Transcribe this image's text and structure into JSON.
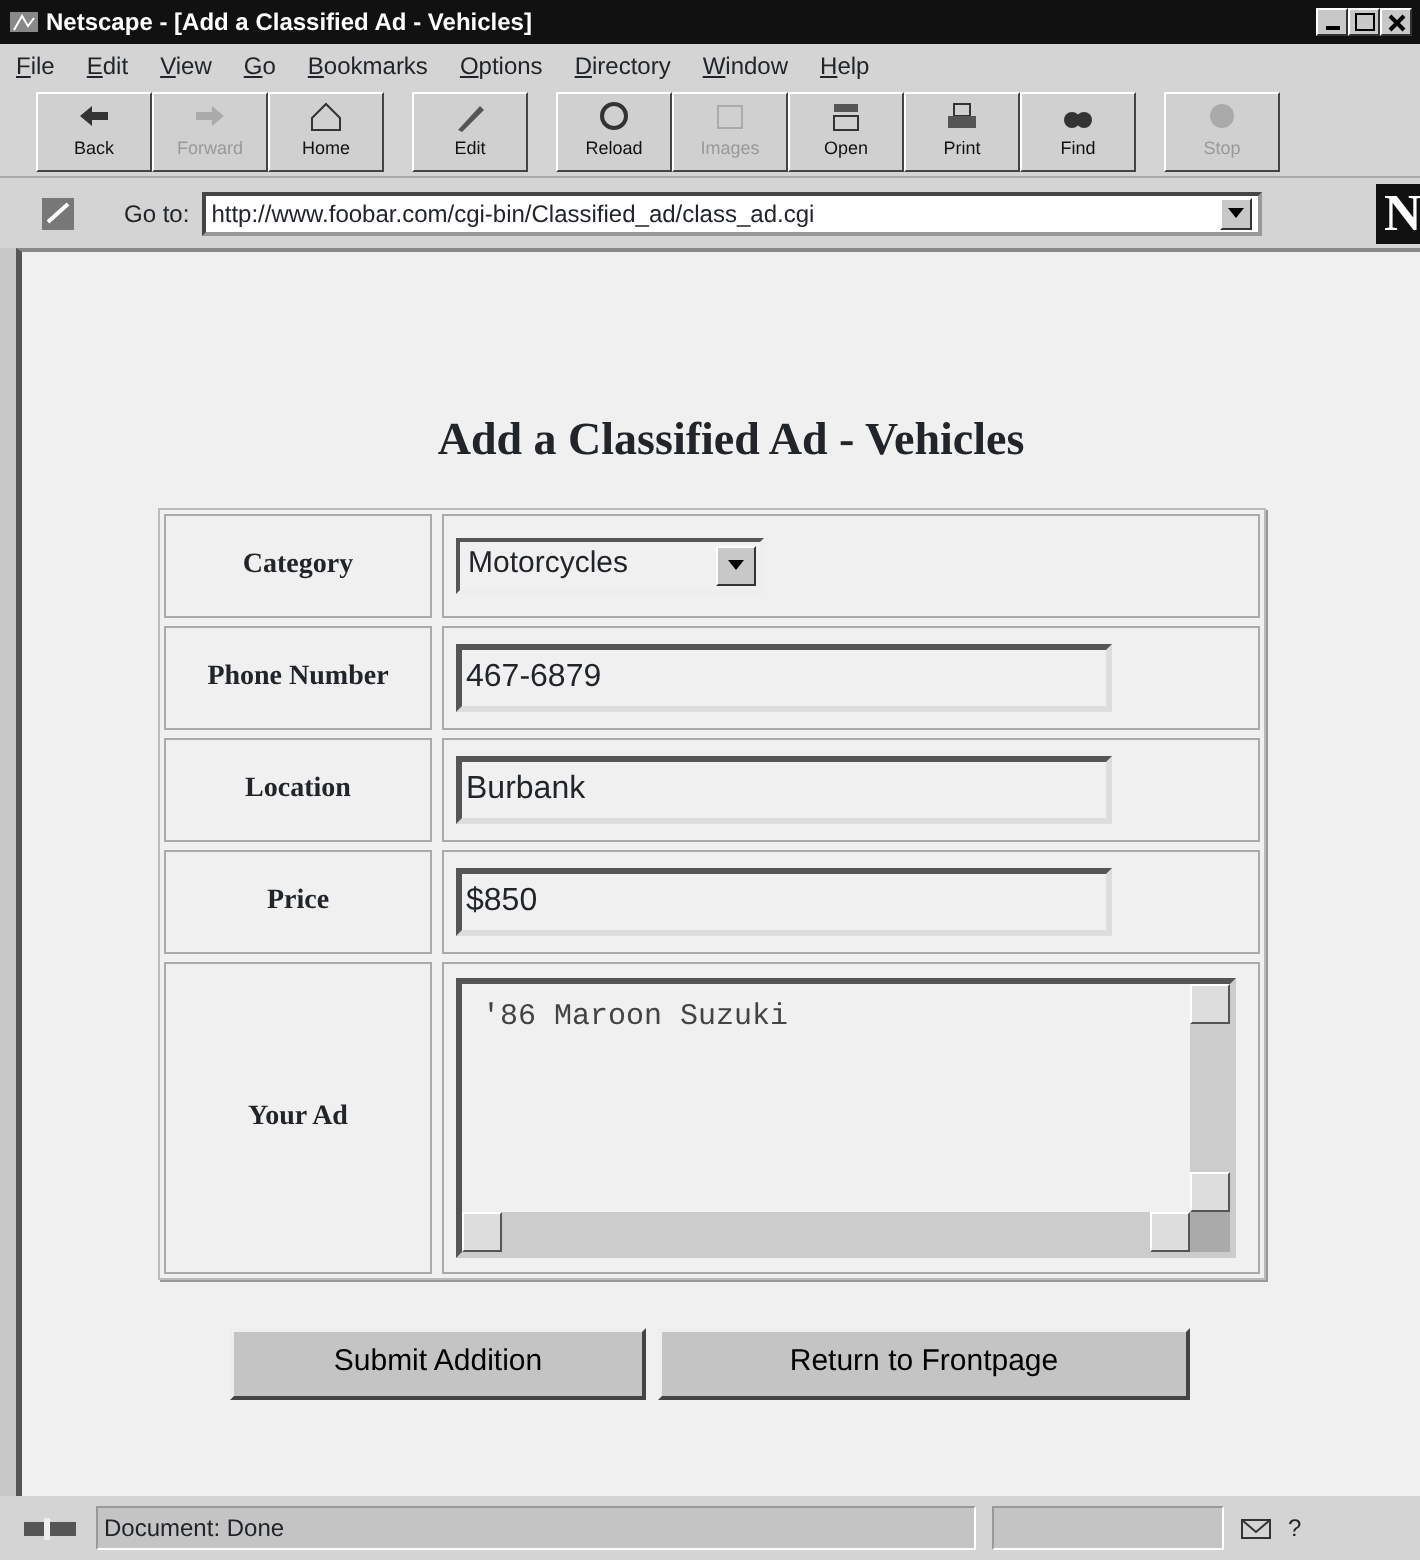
{
  "window": {
    "title": "Netscape - [Add a Classified Ad - Vehicles]"
  },
  "menu": [
    "File",
    "Edit",
    "View",
    "Go",
    "Bookmarks",
    "Options",
    "Directory",
    "Window",
    "Help"
  ],
  "toolbar": [
    {
      "label": "Back",
      "kind": "back",
      "disabled": false,
      "group_start": false
    },
    {
      "label": "Forward",
      "kind": "forward",
      "disabled": true,
      "group_start": false
    },
    {
      "label": "Home",
      "kind": "home",
      "disabled": false,
      "group_start": false
    },
    {
      "label": "Edit",
      "kind": "edit",
      "disabled": false,
      "group_start": true
    },
    {
      "label": "Reload",
      "kind": "reload",
      "disabled": false,
      "group_start": true
    },
    {
      "label": "Images",
      "kind": "images",
      "disabled": true,
      "group_start": false
    },
    {
      "label": "Open",
      "kind": "open",
      "disabled": false,
      "group_start": false
    },
    {
      "label": "Print",
      "kind": "print",
      "disabled": false,
      "group_start": false
    },
    {
      "label": "Find",
      "kind": "find",
      "disabled": false,
      "group_start": false
    },
    {
      "label": "Stop",
      "kind": "stop",
      "disabled": true,
      "group_start": true
    }
  ],
  "location": {
    "label": "Go to:",
    "value": "http://www.foobar.com/cgi-bin/Classified_ad/class_ad.cgi",
    "logo": "N"
  },
  "page": {
    "heading": "Add a Classified Ad - Vehicles",
    "fields": [
      {
        "label": "Category",
        "kind": "select",
        "value": "Motorcycles"
      },
      {
        "label": "Phone Number",
        "kind": "text",
        "value": "467-6879"
      },
      {
        "label": "Location",
        "kind": "text",
        "value": "Burbank"
      },
      {
        "label": "Price",
        "kind": "text",
        "value": "$850"
      },
      {
        "label": "Your Ad",
        "kind": "textarea",
        "value": "'86 Maroon Suzuki"
      }
    ],
    "buttons": [
      "Submit Addition",
      "Return to Frontpage"
    ]
  },
  "status_bar": {
    "text": "Document: Done",
    "help_glyph": "?"
  }
}
